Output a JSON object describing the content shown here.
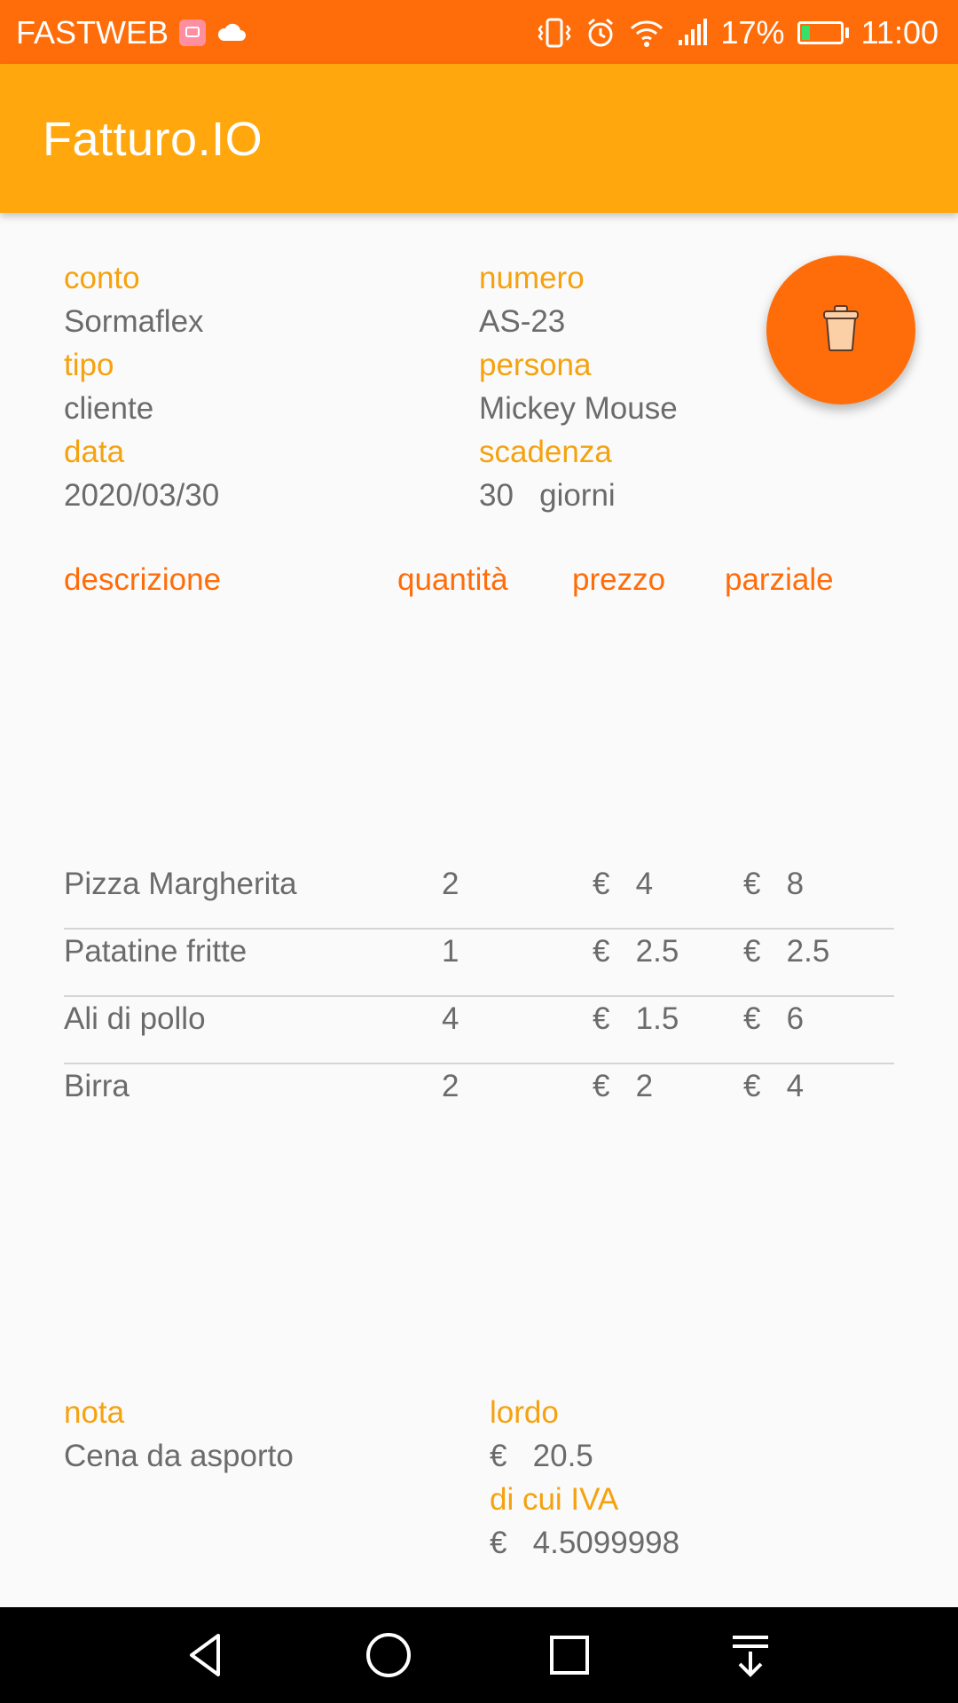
{
  "status_bar": {
    "carrier": "FASTWEB",
    "battery_text": "17%",
    "battery_level": 0.17,
    "time": "11:00",
    "icons": [
      "notification-icon",
      "cloud-icon",
      "vibrate-icon",
      "alarm-icon",
      "wifi-icon",
      "signal-icon",
      "battery-icon"
    ]
  },
  "app_bar": {
    "title": "Fatturo.IO"
  },
  "invoice": {
    "conto_label": "conto",
    "conto_value": "Sormaflex",
    "numero_label": "numero",
    "numero_value": "AS-23",
    "tipo_label": "tipo",
    "tipo_value": "cliente",
    "persona_label": "persona",
    "persona_value": "Mickey Mouse",
    "data_label": "data",
    "data_value": "2020/03/30",
    "scadenza_label": "scadenza",
    "scadenza_value": "30   giorni"
  },
  "fab": {
    "icon": "trash-icon"
  },
  "table": {
    "headers": [
      "descrizione",
      "quantità",
      "prezzo",
      "parziale"
    ],
    "rows": [
      {
        "descrizione": "Pizza Margherita",
        "quantita": "2",
        "prezzo": "€   4",
        "parziale": "€   8"
      },
      {
        "descrizione": "Patatine fritte",
        "quantita": "1",
        "prezzo": "€   2.5",
        "parziale": "€   2.5"
      },
      {
        "descrizione": "Ali di pollo",
        "quantita": "4",
        "prezzo": "€   1.5",
        "parziale": "€   6"
      },
      {
        "descrizione": "Birra",
        "quantita": "2",
        "prezzo": "€   2",
        "parziale": "€   4"
      }
    ]
  },
  "summary": {
    "nota_label": "nota",
    "nota_value": "Cena da asporto",
    "lordo_label": "lordo",
    "lordo_value": "€   20.5",
    "iva_label": "di cui IVA",
    "iva_value": "€   4.5099998"
  },
  "nav_bar": {
    "icons": [
      "back-icon",
      "home-icon",
      "recents-icon",
      "notifications-pull-icon"
    ]
  },
  "colors": {
    "status_bar": "#ff6d0a",
    "app_bar": "#ffa70d",
    "label": "#f5a20f",
    "table_header": "#ff6d0a",
    "fab": "#ff6d0a"
  }
}
